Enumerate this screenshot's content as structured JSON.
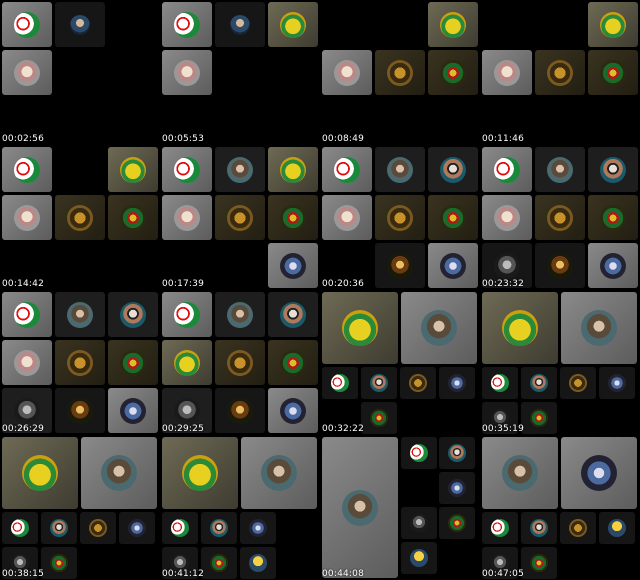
{
  "timestamps": [
    "00:02:56",
    "00:05:53",
    "00:08:49",
    "00:11:46",
    "00:14:42",
    "00:17:39",
    "00:20:36",
    "00:23:32",
    "00:26:29",
    "00:29:25",
    "00:32:22",
    "00:35:19",
    "00:38:15",
    "00:41:12",
    "00:44:08",
    "00:47:05"
  ],
  "avatar_styles": {
    "flag": "radial-gradient(circle at 35% 45%, #ffffff 0 22%, #d11 23% 30%, #fff 31% 48%, #1a8a3a 49%)",
    "man": "radial-gradient(circle at 50% 40%, #d6b89a 0 25%, #2b4a6a 26% 60%, #1a2233 61%)",
    "shirt": "radial-gradient(circle at 50% 55%, #e8d020 0 40%, #2a8a3a 41% 60%, #c9a010 61%)",
    "elder": "radial-gradient(circle at 50% 45%, #f0e0d0 0 28%, #b88 29% 50%, #999 51%)",
    "gold": "radial-gradient(circle at 50% 50%, #c8922a 0 30%, #3a2a10 31% 55%, #7a5a20 56%)",
    "club": "radial-gradient(circle at 50% 50%, #d8c02a 0 18%, #b01818 19% 32%, #1a6a2a 33% 55%, #2a2a10 56%)",
    "beard": "radial-gradient(circle at 50% 45%, #d9c0a8 0 20%, #5a4a3a 21% 45%, #4a6a70 46%)",
    "sunglass": "radial-gradient(circle at 50% 45%, #e8e0d8 0 20%, #222 21% 30%, #b07a5a 31% 50%, #1a5a6a 51%)",
    "blue": "radial-gradient(circle at 50% 50%, #dde 0 20%, #4a6aa0 21% 45%, #223 46%)",
    "smallposter": "radial-gradient(circle at 50% 45%, #e8c060 0 20%, #6a3a10 21% 45%, #1a1a0a 46%)",
    "bust": "radial-gradient(circle at 50% 45%, #bcbcbc 0 22%, #555 23% 45%, #1a1a1a 46%)",
    "sun": "radial-gradient(circle at 50% 40%, #f6d040 0 35%, #2a4a6a 36%)"
  }
}
